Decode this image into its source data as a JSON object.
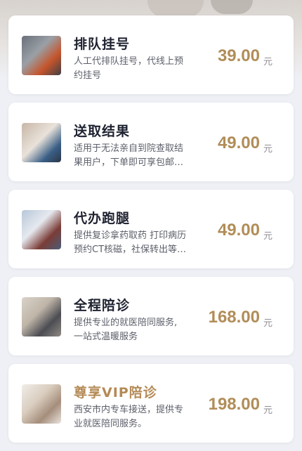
{
  "services": [
    {
      "title": "排队挂号",
      "desc_line1": "人工代排队挂号，代线上预",
      "desc_line2": "约挂号",
      "price": "39.00",
      "unit": "元"
    },
    {
      "title": "送取结果",
      "desc_line1": "适用于无法亲自到院查取结",
      "desc_line2": "果用户，下单即可享包邮…",
      "price": "49.00",
      "unit": "元"
    },
    {
      "title": "代办跑腿",
      "desc_line1": "提供复诊拿药取药 打印病历",
      "desc_line2": "预约CT核磁，社保转出等…",
      "price": "49.00",
      "unit": "元"
    },
    {
      "title": "全程陪诊",
      "desc_line1": "提供专业的就医陪同服务,",
      "desc_line2": "一站式温暖服务",
      "price": "168.00",
      "unit": "元"
    },
    {
      "title": "尊享VIP陪诊",
      "desc_line1": "西安市内专车接送，提供专",
      "desc_line2": "业就医陪同服务。",
      "price": "198.00",
      "unit": "元"
    }
  ],
  "colors": {
    "price": "#b18d58",
    "vip_title": "#b48a56",
    "title": "#1e2230",
    "background": "#eef0f5"
  }
}
